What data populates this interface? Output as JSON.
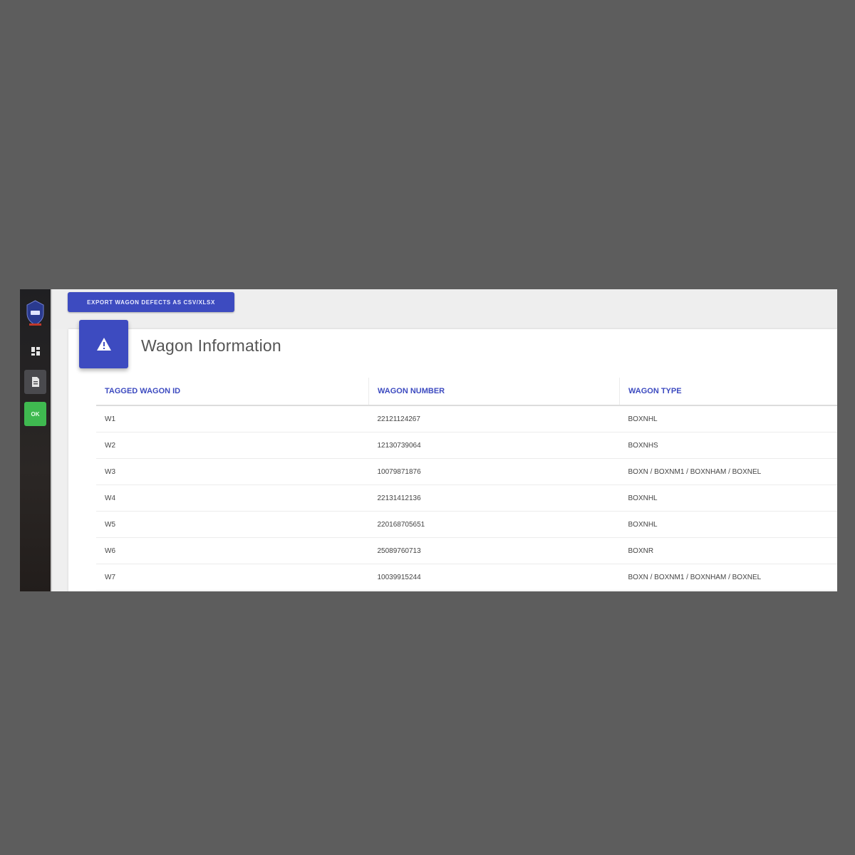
{
  "sidebar": {
    "ok_label": "OK"
  },
  "toolbar": {
    "export_label": "EXPORT WAGON DEFECTS AS CSV/XLSX"
  },
  "card": {
    "title": "Wagon Information"
  },
  "table": {
    "headers": [
      "TAGGED WAGON ID",
      "WAGON NUMBER",
      "WAGON TYPE"
    ],
    "rows": [
      [
        "W1",
        "22121124267",
        "BOXNHL"
      ],
      [
        "W2",
        "12130739064",
        "BOXNHS"
      ],
      [
        "W3",
        "10079871876",
        "BOXN / BOXNM1 / BOXNHAM / BOXNEL"
      ],
      [
        "W4",
        "22131412136",
        "BOXNHL"
      ],
      [
        "W5",
        "220168705651",
        "BOXNHL"
      ],
      [
        "W6",
        "25089760713",
        "BOXNR"
      ],
      [
        "W7",
        "10039915244",
        "BOXN / BOXNM1 / BOXNHAM / BOXNEL"
      ]
    ]
  },
  "colors": {
    "accent": "#3d4bc0",
    "status_ok": "#3fb950",
    "backdrop": "#5d5d5d"
  }
}
